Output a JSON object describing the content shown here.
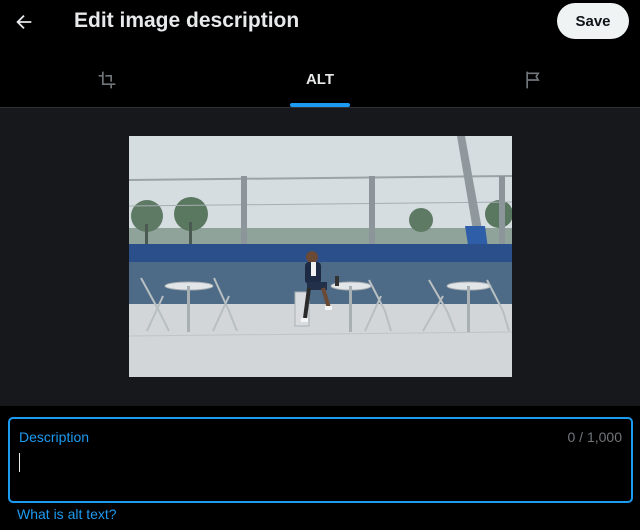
{
  "header": {
    "back_icon": "arrow-left-icon",
    "title": "Edit image description",
    "save_label": "Save"
  },
  "tabs": [
    {
      "icon": "crop-icon",
      "label": ""
    },
    {
      "icon": "",
      "label": "ALT",
      "active": true
    },
    {
      "icon": "flag-icon",
      "label": ""
    }
  ],
  "description": {
    "label": "Description",
    "counter": "0 / 1,000",
    "value": ""
  },
  "help_link": "What is alt text?",
  "colors": {
    "accent": "#1d9bf0",
    "background": "#000000",
    "canvas": "#16181c",
    "text": "#e7e9ea",
    "muted": "#71767b"
  }
}
